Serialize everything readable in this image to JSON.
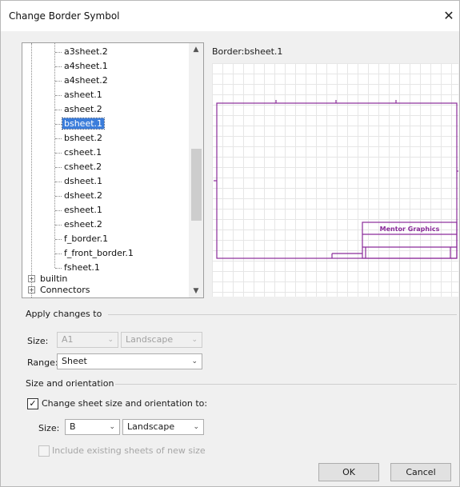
{
  "dialog": {
    "title": "Change Border Symbol",
    "close_glyph": "✕"
  },
  "tree": {
    "items": [
      {
        "label": "a3sheet.2",
        "selected": false
      },
      {
        "label": "a4sheet.1",
        "selected": false
      },
      {
        "label": "a4sheet.2",
        "selected": false
      },
      {
        "label": "asheet.1",
        "selected": false
      },
      {
        "label": "asheet.2",
        "selected": false
      },
      {
        "label": "bsheet.1",
        "selected": true
      },
      {
        "label": "bsheet.2",
        "selected": false
      },
      {
        "label": "csheet.1",
        "selected": false
      },
      {
        "label": "csheet.2",
        "selected": false
      },
      {
        "label": "dsheet.1",
        "selected": false
      },
      {
        "label": "dsheet.2",
        "selected": false
      },
      {
        "label": "esheet.1",
        "selected": false
      },
      {
        "label": "esheet.2",
        "selected": false
      },
      {
        "label": "f_border.1",
        "selected": false
      },
      {
        "label": "f_front_border.1",
        "selected": false
      },
      {
        "label": "fsheet.1",
        "selected": false
      }
    ],
    "groups": [
      {
        "label": "builtin",
        "expander": "+"
      },
      {
        "label": "Connectors",
        "expander": "+"
      }
    ],
    "scroll_up": "▲",
    "scroll_down": "▼"
  },
  "preview": {
    "label": "Border:bsheet.1",
    "border_color": "#8a2b9a",
    "title_block_text": "Mentor Graphics"
  },
  "apply": {
    "title": "Apply changes to",
    "size_label": "Size:",
    "size_value": "A1",
    "orientation_value": "Landscape",
    "range_label": "Range:",
    "range_value": "Sheet"
  },
  "size_orientation": {
    "title": "Size and orientation",
    "change_checkbox_label": "Change sheet size and orientation to:",
    "change_checked": true,
    "check_glyph": "✓",
    "size_label": "Size:",
    "size_value": "B",
    "orientation_value": "Landscape",
    "include_label": "Include existing sheets of new size",
    "include_checked": false
  },
  "buttons": {
    "ok": "OK",
    "cancel": "Cancel"
  },
  "dropdown_glyph": "⌄"
}
